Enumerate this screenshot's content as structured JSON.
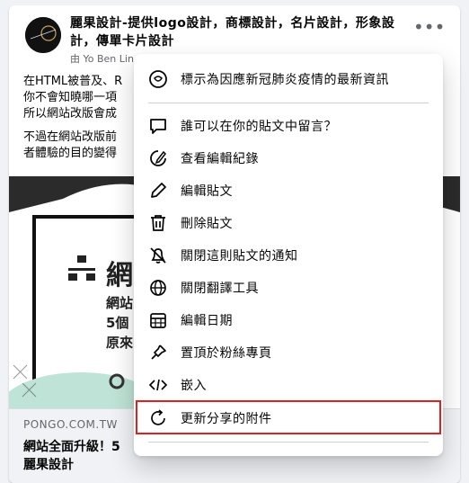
{
  "post": {
    "page_name": "麗果設計-提供logo設計，商標設計，名片設計，形象設計，傳單卡片設計",
    "byline": "由 Yo Ben Lin",
    "more_icon": "more-horizontal-icon",
    "text_lines": [
      "在HTML被普及、R",
      "你不會知曉哪一項",
      "所以網站改版會成",
      "不過在網站改版前",
      "者體驗的目的變得"
    ],
    "image": {
      "title": "網",
      "sub_lines": [
        "網站",
        "5個",
        "原來"
      ]
    },
    "link": {
      "domain": "PONGO.COM.TW",
      "title_line1": "網站全面升級！5",
      "title_line2": "麗果設計"
    }
  },
  "menu": {
    "items": [
      {
        "label": "標示為因應新冠肺炎疫情的最新資訊",
        "icon": "covid-info-icon"
      },
      {
        "label": "誰可以在你的貼文中留言？",
        "icon": "comment-icon"
      },
      {
        "label": "查看編輯紀錄",
        "icon": "edit-history-icon"
      },
      {
        "label": "編輯貼文",
        "icon": "pencil-icon"
      },
      {
        "label": "刪除貼文",
        "icon": "trash-icon"
      },
      {
        "label": "關閉這則貼文的通知",
        "icon": "bell-off-icon"
      },
      {
        "label": "關閉翻譯工具",
        "icon": "globe-icon"
      },
      {
        "label": "編輯日期",
        "icon": "calendar-icon"
      },
      {
        "label": "置頂於粉絲專頁",
        "icon": "pin-icon"
      },
      {
        "label": "嵌入",
        "icon": "code-icon"
      },
      {
        "label": "更新分享的附件",
        "icon": "refresh-icon"
      }
    ],
    "highlight_color": "#e02020"
  }
}
